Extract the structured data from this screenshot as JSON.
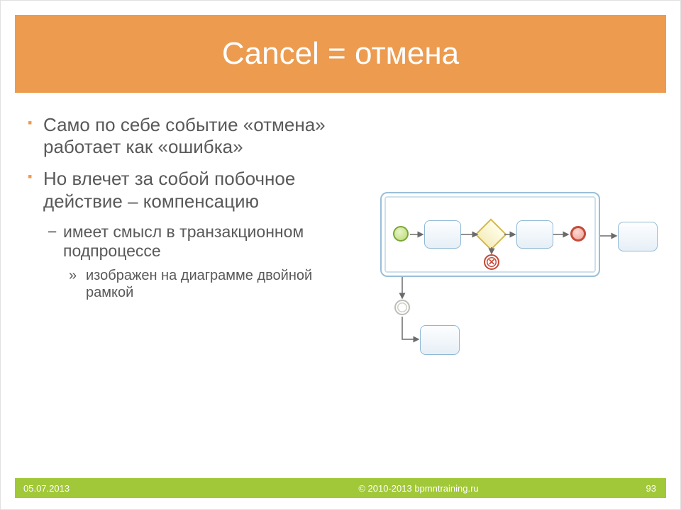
{
  "title": "Cancel = отмена",
  "bullets": {
    "b1": "Само по себе событие «отмена»  работает как «ошибка»",
    "b2": "Но влечет за собой побочное действие – компенсацию",
    "b2_1": "имеет смысл в транзакционном подпроцессе",
    "b2_1_1": "изображен на диаграмме двойной рамкой"
  },
  "diagram": {
    "cancel_glyph": "✕"
  },
  "footer": {
    "date": "05.07.2013",
    "copyright": "© 2010-2013 bpmntraining.ru",
    "page": "93"
  }
}
